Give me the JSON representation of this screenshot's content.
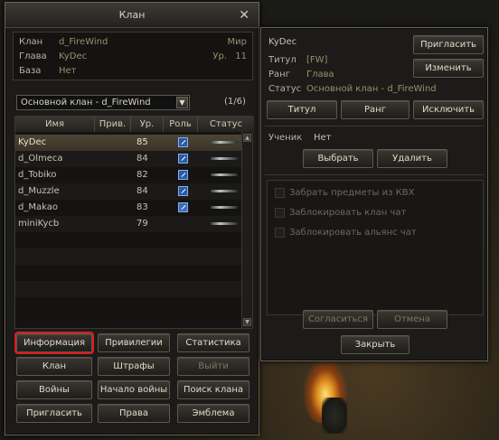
{
  "clan_window": {
    "title": "Клан",
    "info": {
      "clan_label": "Клан",
      "clan_value": "d_FireWind",
      "leader_label": "Глава",
      "leader_value": "KyDec",
      "base_label": "База",
      "base_value": "Нет",
      "world_label": "Мир",
      "level_label": "Ур.",
      "level_value": "11"
    },
    "selector": {
      "selected": "Основной клан - d_FireWind",
      "count": "(1/6)"
    },
    "table": {
      "columns": [
        "Имя",
        "Прив.",
        "Ур.",
        "Роль",
        "Статус"
      ],
      "rows": [
        {
          "name": "KyDec",
          "priv": "",
          "level": "85"
        },
        {
          "name": "d_Olmeca",
          "priv": "",
          "level": "84"
        },
        {
          "name": "d_Tobiko",
          "priv": "",
          "level": "82"
        },
        {
          "name": "d_Muzzle",
          "priv": "",
          "level": "84"
        },
        {
          "name": "d_Makao",
          "priv": "",
          "level": "83"
        },
        {
          "name": "miniKycb",
          "priv": "",
          "level": "79"
        }
      ]
    },
    "buttons": {
      "info": "Информация",
      "privileges": "Привилегии",
      "stats": "Статистика",
      "clan": "Клан",
      "penalties": "Штрафы",
      "exit": "Выйти",
      "wars": "Войны",
      "start_war": "Начало войны",
      "search": "Поиск клана",
      "invite": "Пригласить",
      "rights": "Права",
      "emblem": "Эмблема"
    }
  },
  "member_window": {
    "name": "KyDec",
    "title_label": "Титул",
    "title_value": "[FW]",
    "rank_label": "Ранг",
    "rank_value": "Глава",
    "status_label": "Статус",
    "status_value": "Основной клан - d_FireWind",
    "buttons": {
      "invite": "Пригласить",
      "change": "Изменить",
      "title": "Титул",
      "rank": "Ранг",
      "expel": "Исключить",
      "choose": "Выбрать",
      "remove": "Удалить",
      "agree": "Согласиться",
      "cancel": "Отмена",
      "close": "Закрыть"
    },
    "student_label": "Ученик",
    "student_value": "Нет",
    "checkboxes": [
      "Забрать предметы из КВХ",
      "Заблокировать клан чат",
      "Заблокировать альянс чат"
    ]
  },
  "colors": {
    "highlight": "#e01b1b",
    "accent_text": "#9a8f6a"
  },
  "icons": {
    "close": "close-icon",
    "role": "role-icon",
    "status": "status-icon"
  }
}
